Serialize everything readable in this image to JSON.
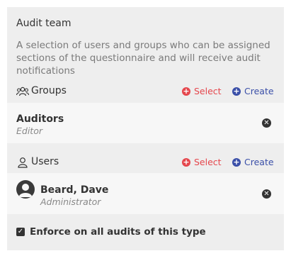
{
  "panel": {
    "title": "Audit team",
    "description": "A selection of users and groups who can be assigned sections of the questionnaire and will receive audit notifications"
  },
  "groups": {
    "label": "Groups",
    "select_label": "Select",
    "create_label": "Create",
    "items": [
      {
        "name": "Auditors",
        "role": "Editor"
      }
    ]
  },
  "users": {
    "label": "Users",
    "select_label": "Select",
    "create_label": "Create",
    "items": [
      {
        "name": "Beard, Dave",
        "role": "Administrator"
      }
    ]
  },
  "enforce": {
    "label": "Enforce on all audits of this type",
    "checked": true
  },
  "icons": {
    "groups": "users-group-icon",
    "users": "user-icon",
    "select": "plus-circle-icon",
    "create": "plus-circle-icon",
    "remove": "x-circle-icon",
    "avatar": "user-avatar-icon",
    "checkbox": "check-icon"
  },
  "colors": {
    "panel_bg": "#eeeeee",
    "row_bg": "#f7f7f7",
    "select": "#e5474d",
    "create": "#3a4fa8",
    "text": "#333333",
    "muted": "#7a7a7a"
  }
}
